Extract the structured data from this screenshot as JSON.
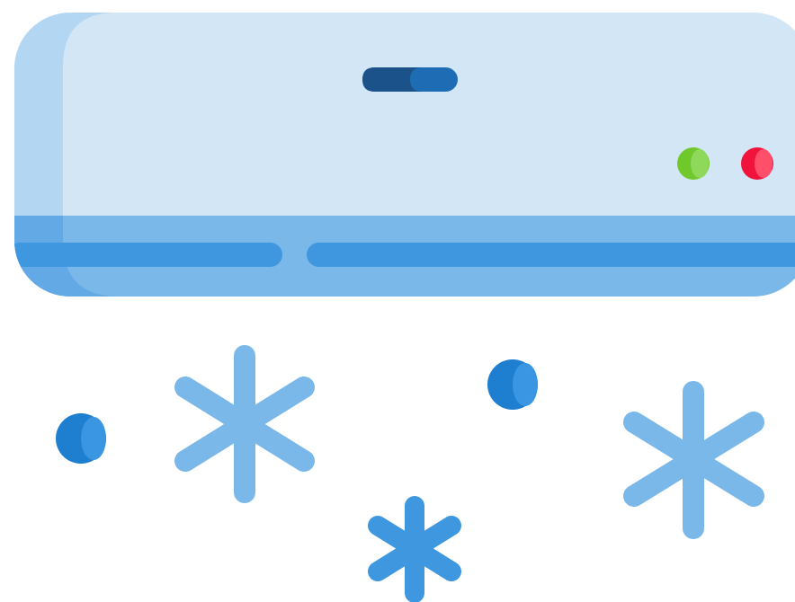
{
  "illustration": {
    "subject": "air-conditioner-icon",
    "colors": {
      "unit_body": "#D3E6F6",
      "unit_side_shade": "#B3D6F2",
      "unit_bottom": "#7BB8EA",
      "vent_slot": "#3F97DF",
      "display_slot_dark": "#1B5289",
      "display_slot_light": "#1E6DB4",
      "led_green": "#6FC92B",
      "led_green_highlight": "#8ED85A",
      "led_red": "#F0143C",
      "led_red_highlight": "#FF4F6B",
      "snowflake_light": "#7BB8EA",
      "snowflake_dark": "#3F97DF",
      "drop": "#1E7ED0",
      "drop_highlight": "#3A95E2"
    },
    "indicators": [
      {
        "name": "power-led",
        "color": "green",
        "state": "on"
      },
      {
        "name": "status-led",
        "color": "red",
        "state": "on"
      }
    ],
    "snowflakes": [
      {
        "name": "snowflake-left",
        "shade": "light"
      },
      {
        "name": "snowflake-center",
        "shade": "dark"
      },
      {
        "name": "snowflake-right",
        "shade": "light"
      }
    ],
    "drops": [
      {
        "name": "drop-left"
      },
      {
        "name": "drop-center"
      }
    ]
  }
}
